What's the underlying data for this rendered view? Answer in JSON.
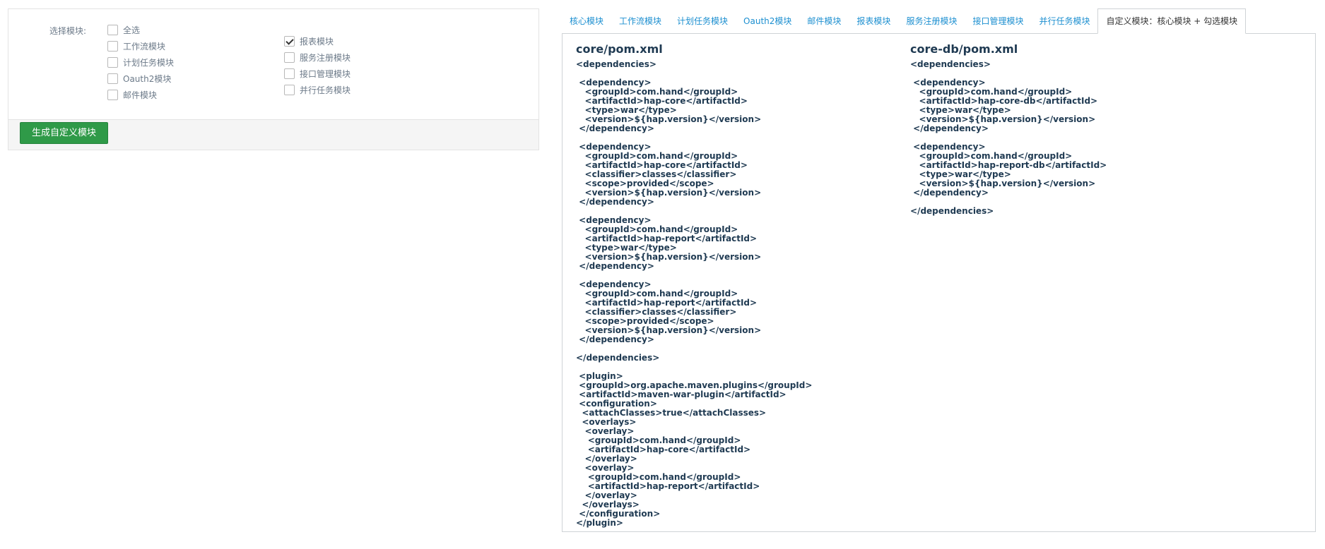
{
  "form": {
    "select_label": "选择模块:",
    "options": [
      {
        "label": "全选",
        "checked": false
      },
      {
        "label": "工作流模块",
        "checked": false
      },
      {
        "label": "计划任务模块",
        "checked": false
      },
      {
        "label": "Oauth2模块",
        "checked": false
      },
      {
        "label": "邮件模块",
        "checked": false
      },
      {
        "label": "报表模块",
        "checked": true
      },
      {
        "label": "服务注册模块",
        "checked": false
      },
      {
        "label": "接口管理模块",
        "checked": false
      },
      {
        "label": "并行任务模块",
        "checked": false
      }
    ],
    "generate_button": "生成自定义模块"
  },
  "tabs": [
    {
      "label": "核心模块",
      "active": false
    },
    {
      "label": "工作流模块",
      "active": false
    },
    {
      "label": "计划任务模块",
      "active": false
    },
    {
      "label": "Oauth2模块",
      "active": false
    },
    {
      "label": "邮件模块",
      "active": false
    },
    {
      "label": "报表模块",
      "active": false
    },
    {
      "label": "服务注册模块",
      "active": false
    },
    {
      "label": "接口管理模块",
      "active": false
    },
    {
      "label": "并行任务模块",
      "active": false
    },
    {
      "label": "自定义模块：核心模块 + 勾选模块",
      "active": true
    }
  ],
  "content": {
    "left_file": {
      "title": "core/pom.xml",
      "code": "<dependencies>\n\n <dependency>\n   <groupId>com.hand</groupId>\n   <artifactId>hap-core</artifactId>\n   <type>war</type>\n   <version>${hap.version}</version>\n </dependency>\n\n <dependency>\n   <groupId>com.hand</groupId>\n   <artifactId>hap-core</artifactId>\n   <classifier>classes</classifier>\n   <scope>provided</scope>\n   <version>${hap.version}</version>\n </dependency>\n\n <dependency>\n   <groupId>com.hand</groupId>\n   <artifactId>hap-report</artifactId>\n   <type>war</type>\n   <version>${hap.version}</version>\n </dependency>\n\n <dependency>\n   <groupId>com.hand</groupId>\n   <artifactId>hap-report</artifactId>\n   <classifier>classes</classifier>\n   <scope>provided</scope>\n   <version>${hap.version}</version>\n </dependency>\n\n</dependencies>\n\n <plugin>\n <groupId>org.apache.maven.plugins</groupId>\n <artifactId>maven-war-plugin</artifactId>\n <configuration>\n  <attachClasses>true</attachClasses>\n  <overlays>\n   <overlay>\n    <groupId>com.hand</groupId>\n    <artifactId>hap-core</artifactId>\n   </overlay>\n   <overlay>\n    <groupId>com.hand</groupId>\n    <artifactId>hap-report</artifactId>\n   </overlay>\n  </overlays>\n </configuration>\n</plugin>"
    },
    "right_file": {
      "title": "core-db/pom.xml",
      "code": "<dependencies>\n\n <dependency>\n   <groupId>com.hand</groupId>\n   <artifactId>hap-core-db</artifactId>\n   <type>war</type>\n   <version>${hap.version}</version>\n </dependency>\n\n <dependency>\n   <groupId>com.hand</groupId>\n   <artifactId>hap-report-db</artifactId>\n   <type>war</type>\n   <version>${hap.version}</version>\n </dependency>\n\n</dependencies>"
    }
  }
}
